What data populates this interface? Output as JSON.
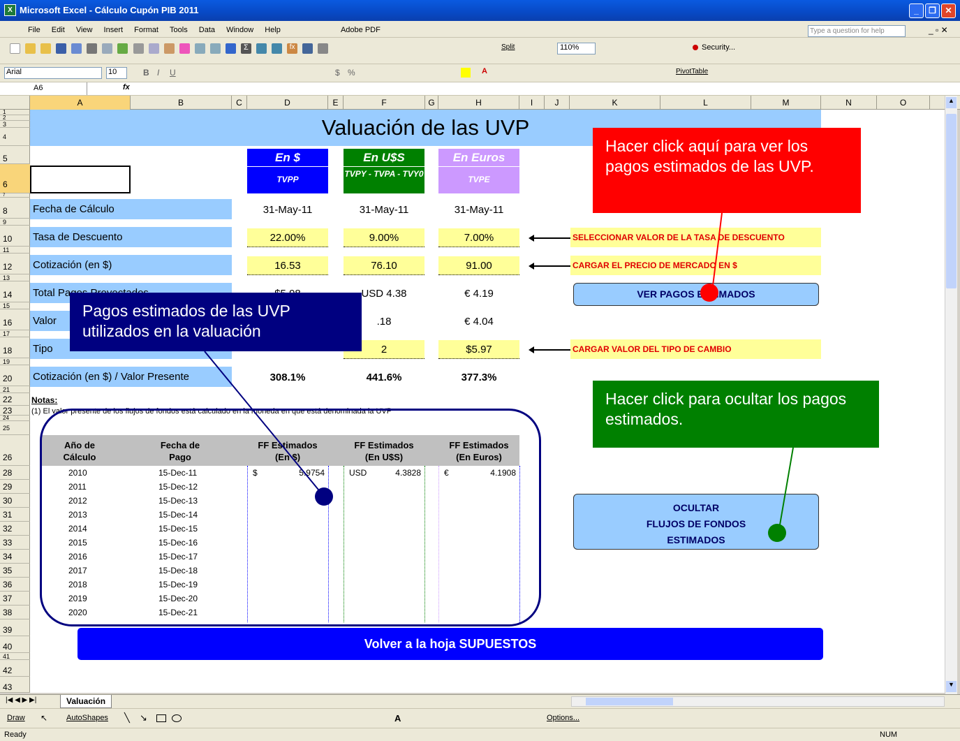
{
  "window": {
    "title": "Microsoft Excel - Cálculo Cupón PIB 2011"
  },
  "menu": [
    "File",
    "Edit",
    "View",
    "Insert",
    "Format",
    "Tools",
    "Data",
    "Window",
    "Help",
    "Adobe PDF"
  ],
  "help_box": {
    "placeholder": "Type a question for help"
  },
  "toolbar": {
    "zoom": "110%",
    "split": "Split",
    "security": "Security...",
    "font": "Arial",
    "font_size": "10",
    "pivot": "PivotTable"
  },
  "formula_bar": {
    "name_box": "A6",
    "fx": "fx",
    "formula": ""
  },
  "columns": [
    "A",
    "B",
    "C",
    "D",
    "E",
    "F",
    "G",
    "H",
    "I",
    "J",
    "K",
    "L",
    "M",
    "N",
    "O"
  ],
  "rows": [
    "1",
    "2",
    "3",
    "4",
    "5",
    "6",
    "7",
    "8",
    "9",
    "10",
    "11",
    "12",
    "13",
    "14",
    "15",
    "16",
    "17",
    "18",
    "19",
    "20",
    "21",
    "22",
    "23",
    "24",
    "25",
    "26",
    "28",
    "29",
    "30",
    "31",
    "32",
    "33",
    "34",
    "35",
    "36",
    "37",
    "38",
    "39",
    "40",
    "41",
    "42",
    "43"
  ],
  "sheet": {
    "title": "Valuación de las UVP",
    "headers": [
      {
        "top": "En $",
        "bottom": "TVPP",
        "color": "#0000ff"
      },
      {
        "top": "En U$S",
        "bottom": "TVPY - TVPA - TVY0",
        "color": "#008000"
      },
      {
        "top": "En Euros",
        "bottom": "TVPE",
        "color": "#cc99ff"
      }
    ],
    "labels": {
      "fecha": "Fecha de Cálculo",
      "tasa": "Tasa de Descuento",
      "cotizacion": "Cotización (en $)",
      "total": "Total Pagos Proyectados",
      "valor": "Valor",
      "tipo": "Tipo",
      "ratio": "Cotización (en $) / Valor Presente"
    },
    "fecha": [
      "31-May-11",
      "31-May-11",
      "31-May-11"
    ],
    "tasa": [
      "22.00%",
      "9.00%",
      "7.00%"
    ],
    "cotizacion": [
      "16.53",
      "76.10",
      "91.00"
    ],
    "total": [
      "$5.98",
      "USD 4.38",
      "€ 4.19"
    ],
    "valor_presente": [
      ".18",
      "€ 4.04"
    ],
    "tipo": [
      "2",
      "$5.97"
    ],
    "ratio": [
      "308.1%",
      "441.6%",
      "377.3%"
    ],
    "notes_title": "Notas:",
    "note1": "(1) El valor presente de los flujos de fondos está calculado en la moneda en que está denominada la UVP",
    "instr_tasa": "SELECCIONAR VALOR DE LA TASA DE DESCUENTO",
    "instr_precio": "CARGAR EL PRECIO DE MERCADO EN $",
    "instr_cambio": "CARGAR VALOR DEL TIPO DE CAMBIO",
    "btn_ver": "VER PAGOS ESTIMADOS",
    "btn_ocultar_1": "OCULTAR",
    "btn_ocultar_2": "FLUJOS DE FONDOS",
    "btn_ocultar_3": "ESTIMADOS",
    "btn_volver": "Volver a la hoja SUPUESTOS",
    "table": {
      "headers": [
        [
          "Año de",
          "Cálculo"
        ],
        [
          "Fecha de",
          "Pago"
        ],
        [
          "FF Estimados",
          "(En $)"
        ],
        [
          "FF Estimados",
          "(En U$S)"
        ],
        [
          "FF Estimados",
          "(En Euros)"
        ]
      ],
      "rows": [
        [
          "2010",
          "15-Dec-11"
        ],
        [
          "2011",
          "15-Dec-12"
        ],
        [
          "2012",
          "15-Dec-13"
        ],
        [
          "2013",
          "15-Dec-14"
        ],
        [
          "2014",
          "15-Dec-15"
        ],
        [
          "2015",
          "15-Dec-16"
        ],
        [
          "2016",
          "15-Dec-17"
        ],
        [
          "2017",
          "15-Dec-18"
        ],
        [
          "2018",
          "15-Dec-19"
        ],
        [
          "2019",
          "15-Dec-20"
        ],
        [
          "2020",
          "15-Dec-21"
        ]
      ],
      "first_row_values": [
        {
          "cur": "$",
          "val": "5.9754"
        },
        {
          "cur": "USD",
          "val": "4.3828"
        },
        {
          "cur": "€",
          "val": "4.1908"
        }
      ]
    }
  },
  "callouts": {
    "red": "Hacer click aquí para ver los pagos estimados de las UVP.",
    "navy": "Pagos estimados de las UVP utilizados en la valuación",
    "green": "Hacer click para ocultar los pagos estimados."
  },
  "callout_colors": {
    "red": "#ff0000",
    "navy": "#000080",
    "green": "#008000"
  },
  "tabs": {
    "active": "Valuación"
  },
  "drawbar": {
    "draw": "Draw",
    "autoshapes": "AutoShapes",
    "options": "Options..."
  },
  "status": {
    "ready": "Ready",
    "num": "NUM"
  }
}
